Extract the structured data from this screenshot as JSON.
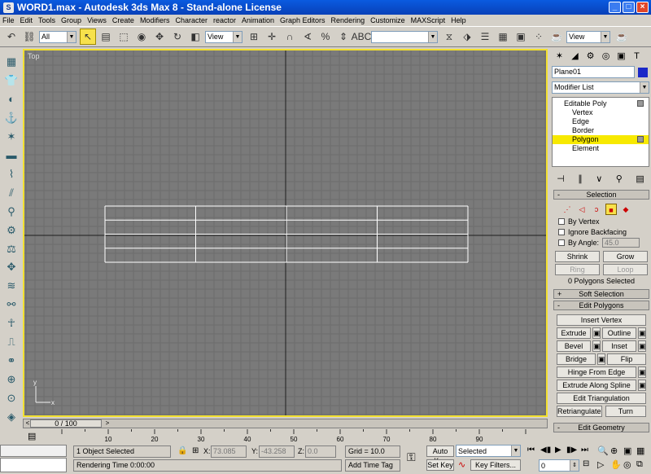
{
  "window": {
    "title": "WORD1.max - Autodesk 3ds Max 8  - Stand-alone License",
    "icon": "S"
  },
  "menu": [
    "File",
    "Edit",
    "Tools",
    "Group",
    "Views",
    "Create",
    "Modifiers",
    "Character",
    "reactor",
    "Animation",
    "Graph Editors",
    "Rendering",
    "Customize",
    "MAXScript",
    "Help"
  ],
  "toolbar": {
    "selection_filter": "All",
    "ref_coord": "View",
    "named_selection": "",
    "render_view": "View"
  },
  "viewport": {
    "label": "Top"
  },
  "timeline": {
    "frame_display": "0 / 100",
    "ticks": [
      "10",
      "20",
      "30",
      "40",
      "50",
      "60",
      "70",
      "80",
      "90"
    ]
  },
  "status": {
    "selection": "1 Object Selected",
    "render_time": "Rendering Time  0:00:00",
    "x_label": "X:",
    "x_value": "73.085",
    "y_label": "Y:",
    "y_value": "-43.258",
    "z_label": "Z:",
    "z_value": "0.0",
    "grid": "Grid = 10.0",
    "add_time_tag": "Add Time Tag",
    "auto_key": "Auto Key",
    "set_key": "Set Key",
    "key_mode": "Selected",
    "key_filters": "Key Filters...",
    "frame": "0"
  },
  "panel": {
    "object_name": "Plane01",
    "object_color": "#1a28c8",
    "modifier_list": "Modifier List",
    "stack": [
      {
        "label": "Editable Poly",
        "top": true
      },
      {
        "label": "Vertex"
      },
      {
        "label": "Edge"
      },
      {
        "label": "Border"
      },
      {
        "label": "Polygon",
        "selected": true
      },
      {
        "label": "Element"
      }
    ],
    "selection": {
      "title": "Selection",
      "by_vertex": "By Vertex",
      "ignore_backfacing": "Ignore Backfacing",
      "by_angle": "By Angle:",
      "angle_value": "45.0",
      "shrink": "Shrink",
      "grow": "Grow",
      "ring": "Ring",
      "loop": "Loop",
      "info": "0 Polygons Selected"
    },
    "soft_selection": {
      "title": "Soft Selection",
      "pm": "+"
    },
    "edit_polygons": {
      "title": "Edit Polygons",
      "pm": "-",
      "insert_vertex": "Insert Vertex",
      "extrude": "Extrude",
      "outline": "Outline",
      "bevel": "Bevel",
      "inset": "Inset",
      "bridge": "Bridge",
      "flip": "Flip",
      "hinge": "Hinge From Edge",
      "extrude_spline": "Extrude Along Spline",
      "edit_tri": "Edit Triangulation",
      "retriangulate": "Retriangulate",
      "turn": "Turn"
    },
    "edit_geometry": {
      "title": "Edit Geometry"
    }
  }
}
